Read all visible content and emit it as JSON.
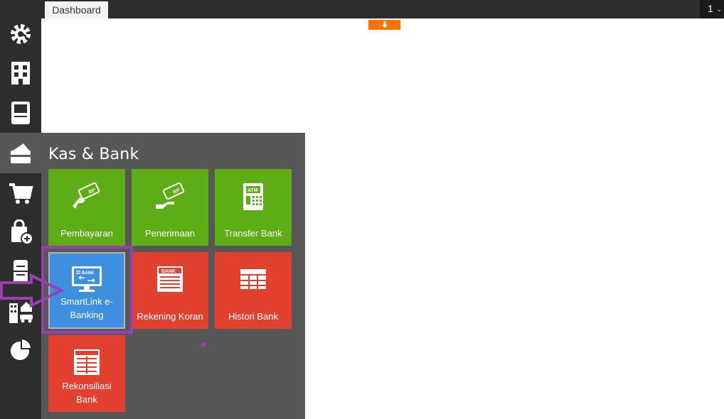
{
  "topbar": {
    "tab_label": "Dashboard",
    "right_number": "1",
    "right_chevron": "⌄"
  },
  "sidebar": {
    "items": [
      {
        "icon": "settings-gear-icon"
      },
      {
        "icon": "building-icon"
      },
      {
        "icon": "notebook-icon"
      },
      {
        "icon": "wallet-icon",
        "active": true
      },
      {
        "icon": "shopping-cart-icon"
      },
      {
        "icon": "shopping-bag-add-icon"
      },
      {
        "icon": "cabinet-icon"
      },
      {
        "icon": "asset-building-car-icon"
      },
      {
        "icon": "pie-chart-icon"
      }
    ]
  },
  "panel": {
    "title": "Kas & Bank",
    "tiles": [
      {
        "label": "Pembayaran",
        "color": "#5fad16",
        "icon": "payment-card-hand-icon"
      },
      {
        "label": "Penerimaan",
        "color": "#5fad16",
        "icon": "receive-card-hand-icon"
      },
      {
        "label": "Transfer Bank",
        "color": "#5fad16",
        "icon": "atm-icon"
      },
      {
        "label": "SmartLink e-Banking",
        "color": "#3e8fe0",
        "icon": "monitor-bank-transfer-icon"
      },
      {
        "label": "Rekening Koran",
        "color": "#e24130",
        "icon": "bank-statement-icon"
      },
      {
        "label": "Histori Bank",
        "color": "#e24130",
        "icon": "table-grid-icon"
      },
      {
        "label": "Rekonsiliasi Bank",
        "color": "#e24130",
        "icon": "reconcile-sheet-icon"
      }
    ]
  },
  "icon_text": {
    "rp": "RP",
    "atm": "ATM",
    "bank": "BANK"
  },
  "colors": {
    "accent_orange": "#ff7300",
    "annotation_purple": "#9a3fae",
    "sidebar_bg": "#2d2d2d",
    "panel_bg": "#575757"
  }
}
